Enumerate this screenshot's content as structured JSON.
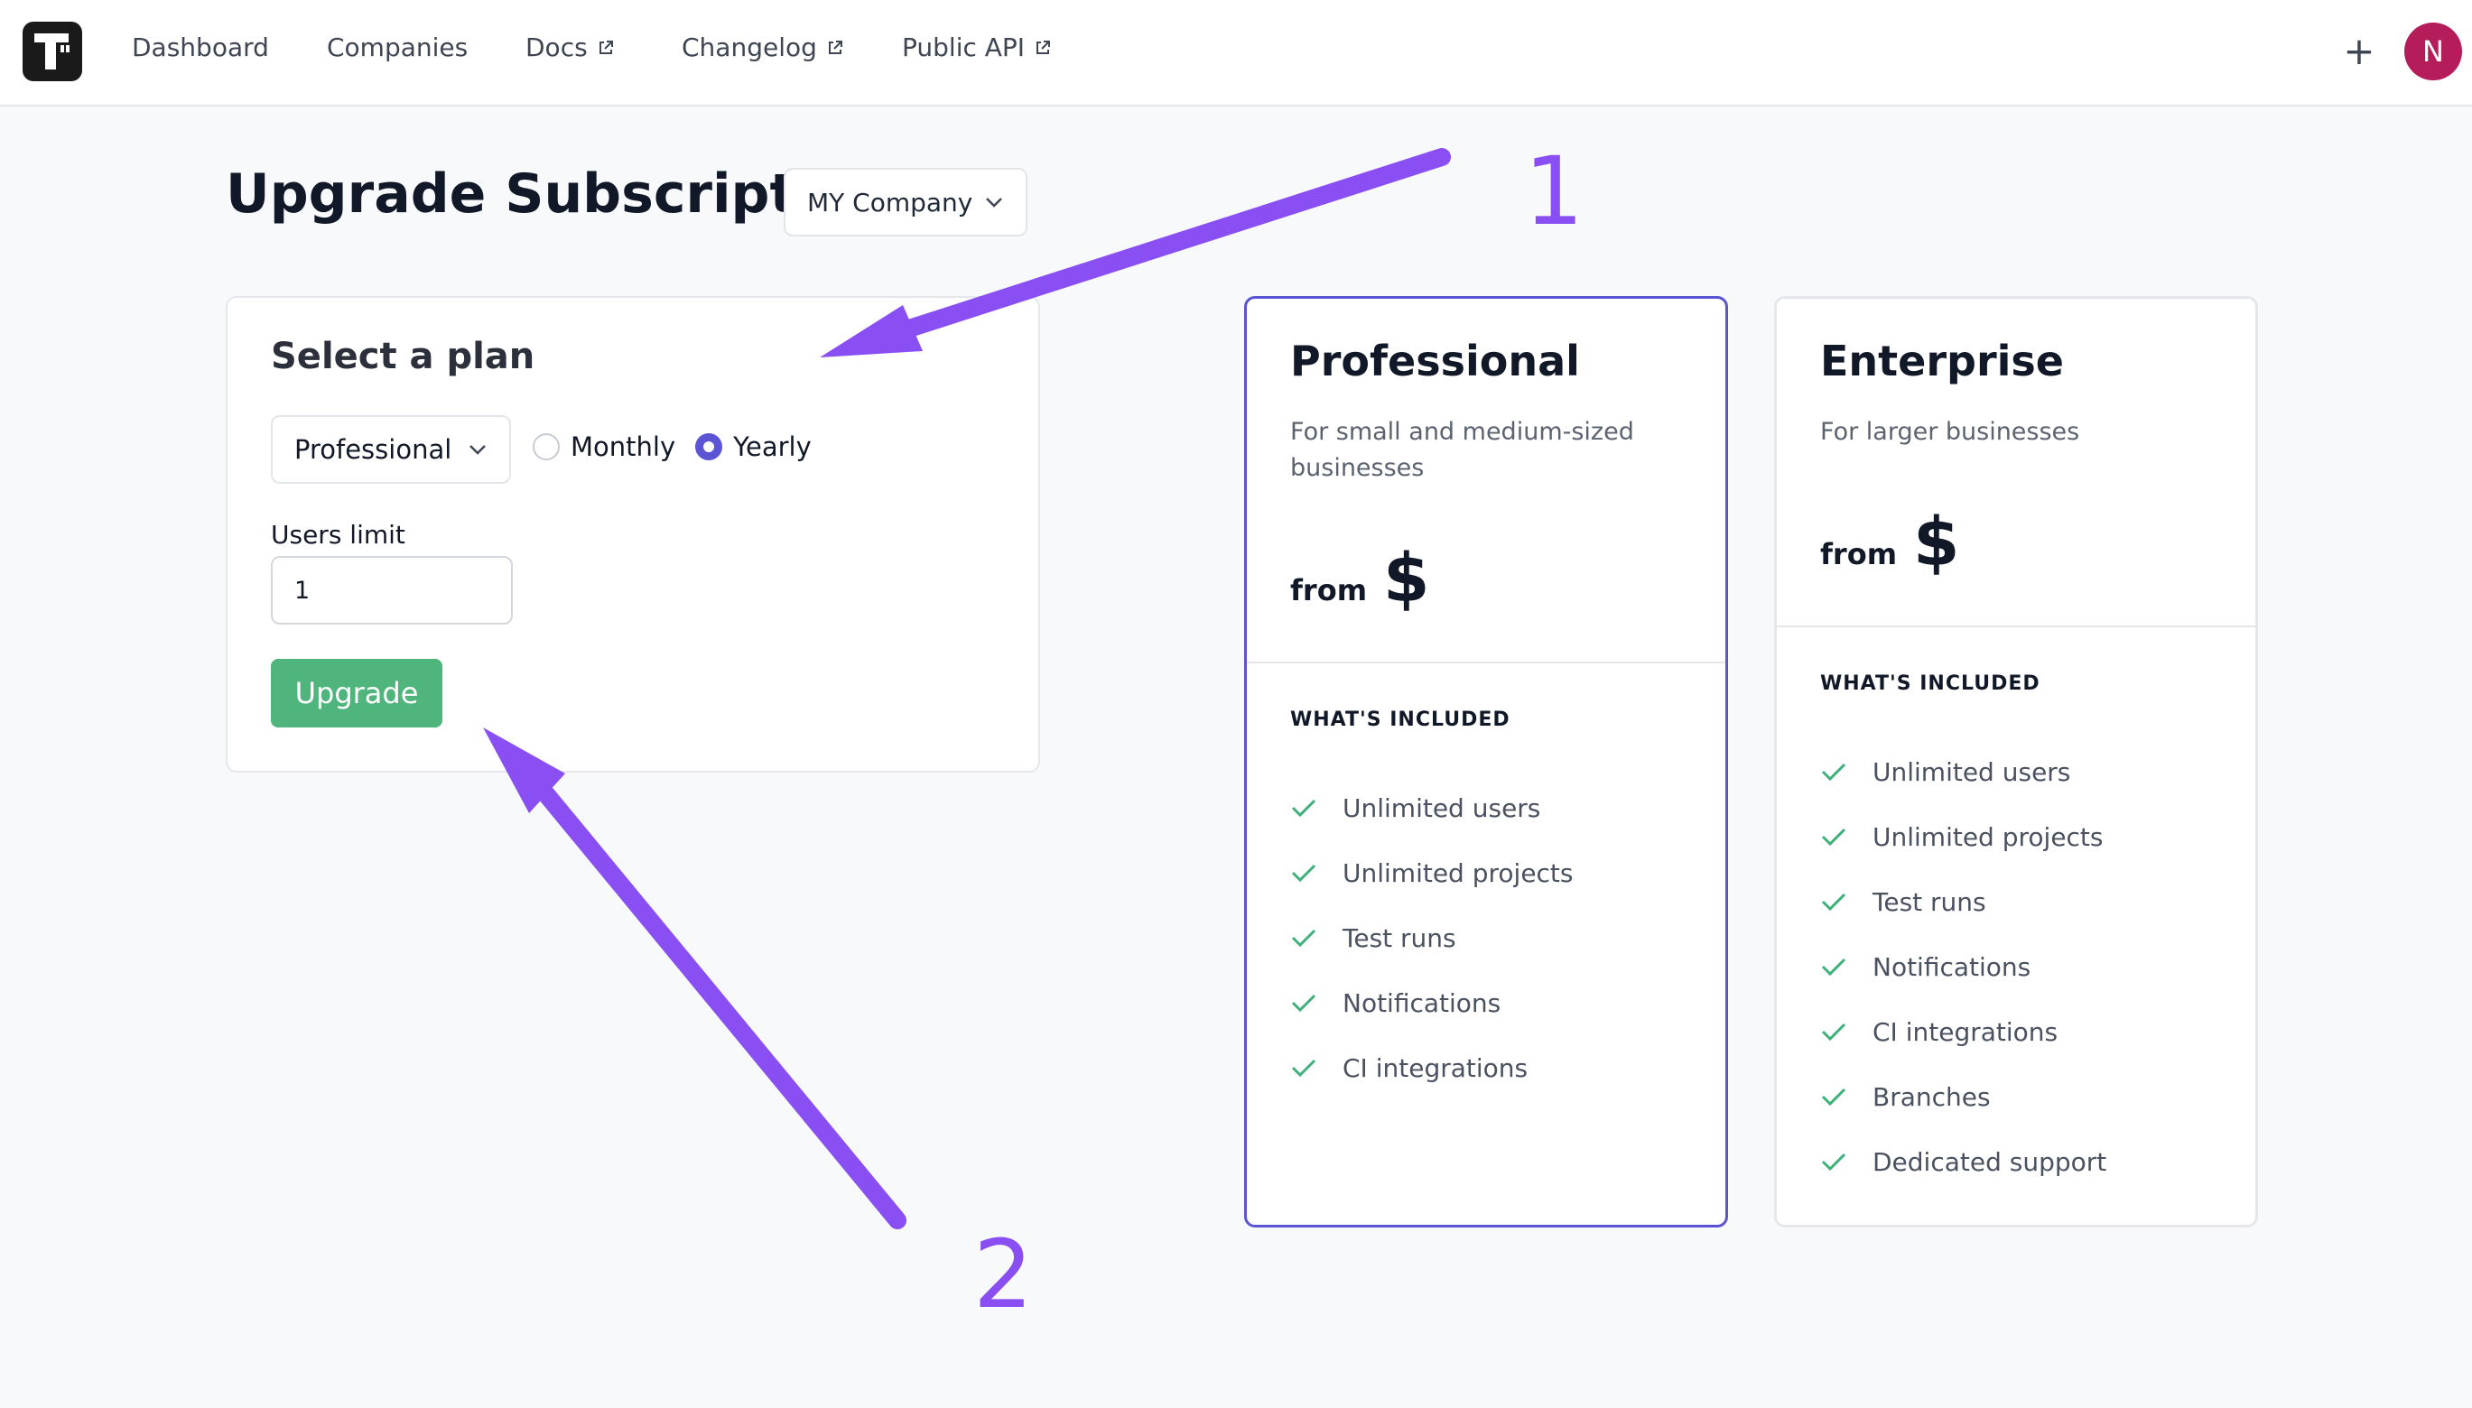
{
  "nav": {
    "items": [
      {
        "label": "Dashboard",
        "external": false
      },
      {
        "label": "Companies",
        "external": false
      },
      {
        "label": "Docs",
        "external": true
      },
      {
        "label": "Changelog",
        "external": true
      },
      {
        "label": "Public API",
        "external": true
      }
    ],
    "plus_label": "+",
    "avatar_initial": "N"
  },
  "page": {
    "title": "Upgrade Subscription",
    "company_selected": "MY Company"
  },
  "plan_form": {
    "heading": "Select a plan",
    "plan_selected": "Professional",
    "billing_options": [
      {
        "label": "Monthly",
        "checked": false
      },
      {
        "label": "Yearly",
        "checked": true
      }
    ],
    "users_limit_label": "Users limit",
    "users_limit_value": "1",
    "upgrade_label": "Upgrade"
  },
  "tiers": [
    {
      "name": "Professional",
      "description": "For small and medium-sized businesses",
      "from_label": "from",
      "price": "$",
      "included_title": "WHAT'S INCLUDED",
      "features": [
        "Unlimited users",
        "Unlimited projects",
        "Test runs",
        "Notifications",
        "CI integrations"
      ],
      "selected": true
    },
    {
      "name": "Enterprise",
      "description": "For larger businesses",
      "from_label": "from",
      "price": "$",
      "included_title": "WHAT'S INCLUDED",
      "features": [
        "Unlimited users",
        "Unlimited projects",
        "Test runs",
        "Notifications",
        "CI integrations",
        "Branches",
        "Dedicated support"
      ],
      "selected": false
    }
  ],
  "annotations": [
    {
      "number": "1"
    },
    {
      "number": "2"
    }
  ],
  "colors": {
    "accent": "#5b55d6",
    "upgrade_button": "#4fb57d",
    "check": "#3fb07a",
    "annotation": "#8a4ff2",
    "avatar": "#b41c5a"
  }
}
